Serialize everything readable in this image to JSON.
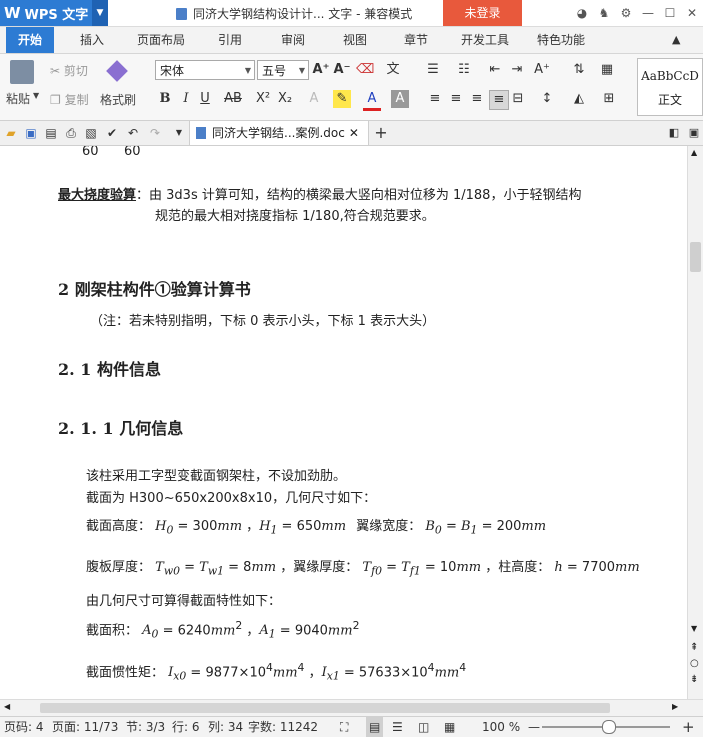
{
  "titlebar": {
    "app_name": "WPS 文字",
    "doc_title": "同济大学钢结构设计计... 文字 - 兼容模式",
    "login_label": "未登录"
  },
  "menu": {
    "tabs": [
      "开始",
      "插入",
      "页面布局",
      "引用",
      "审阅",
      "视图",
      "章节",
      "开发工具",
      "特色功能"
    ]
  },
  "ribbon": {
    "paste": "粘贴",
    "cut": "剪切",
    "copy": "复制",
    "format_painter": "格式刷",
    "font_name": "宋体",
    "font_size": "五号",
    "style_preview": "AaBbCcD",
    "style_name": "正文"
  },
  "doc_tab": {
    "label": "同济大学钢结...案例.doc"
  },
  "document": {
    "top_numbers": [
      "60",
      "60"
    ],
    "deflection_label": "最大挠度验算",
    "deflection_line1": "：由 3d3s 计算可知，结构的横梁最大竖向相对位移为 1/188，小于轻钢结构",
    "deflection_line2": "规范的最大相对挠度指标 1/180,符合规范要求。",
    "heading_2": "2 刚架柱构件①验算计算书",
    "note": "（注：若未特别指明，下标 0 表示小头，下标 1 表示大头）",
    "heading_2_1": "2. 1 构件信息",
    "heading_2_1_1": "2. 1. 1 几何信息",
    "para1": "该柱采用工字型变截面钢架柱，不设加劲肋。",
    "para2": "截面为 H300~650x200x8x10，几何尺寸如下：",
    "line_height_label": "截面高度：",
    "h0": "H",
    "h0_eq": " = 300",
    "h1_eq": " = 650",
    "mm": "mm",
    "flange_width_label": "翼缘宽度：",
    "b_eq": " = 200",
    "web_label": "腹板厚度：",
    "tw_eq": " = 8",
    "flange_t_label": "，翼缘厚度：",
    "tf_eq": " = 10",
    "col_height_label": "，柱高度：",
    "h_eq": " = 7700",
    "para3": "由几何尺寸可算得截面特性如下：",
    "area_label": "截面积：",
    "a0_val": " = 6240",
    "a1_val": " = 9040",
    "inertia_label": "截面惯性矩：",
    "ix0_val": " = 9877",
    "ix1_val": " = 57633",
    "times10": "×10",
    "exp4": "4",
    "exp2": "2"
  },
  "status": {
    "page_code": "页码: 4",
    "pages": "页面: 11/73",
    "section": "节: 3/3",
    "row": "行: 6",
    "col": "列: 34",
    "words": "字数: 11242",
    "zoom": "100 %"
  }
}
